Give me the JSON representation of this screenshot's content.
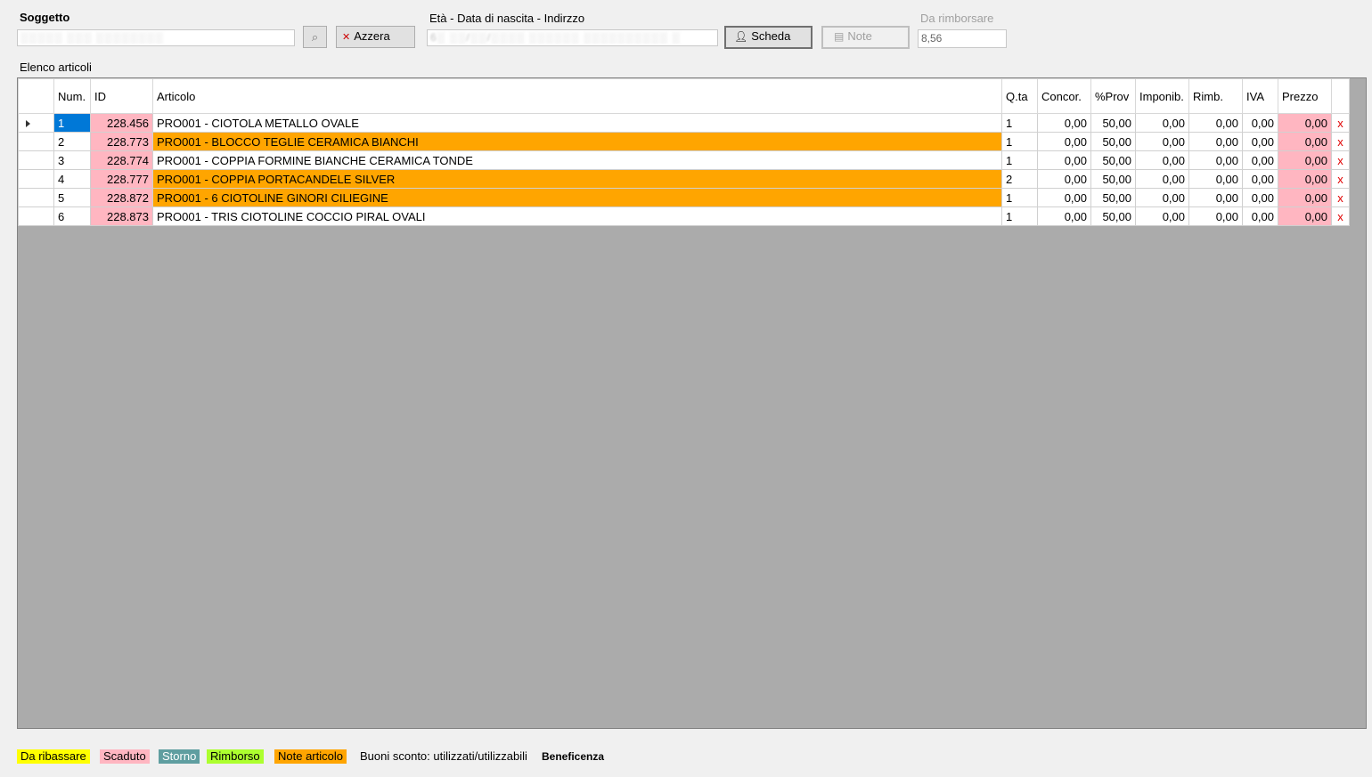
{
  "header": {
    "soggetto_label": "Soggetto",
    "soggetto_value": "░░░░░ ░░░ ░░░░░░░░",
    "azzera_label": "Azzera",
    "info_label": "Età - Data di nascita - Indirzzo",
    "info_value": "6░ ░░/░░/░░░░  ░░░░░░  ░░░░░░░░░░ ░",
    "scheda_label": "Scheda",
    "note_label": "Note",
    "rimborsare_label": "Da rimborsare",
    "rimborsare_value": "8,56"
  },
  "list_title": "Elenco articoli",
  "columns": [
    "Num.",
    "ID",
    "Articolo",
    "Q.ta",
    "Concor.",
    "%Prov",
    "Imponib.",
    "Rimb.",
    "IVA",
    "Prezzo"
  ],
  "rows": [
    {
      "num": "1",
      "id": "228.456",
      "articolo": "PRO001 - CIOTOLA METALLO OVALE",
      "qta": "1",
      "concor": "0,00",
      "prov": "50,00",
      "imponib": "0,00",
      "rimb": "0,00",
      "iva": "0,00",
      "prezzo": "0,00",
      "del": "x",
      "highlight": false,
      "selected": true
    },
    {
      "num": "2",
      "id": "228.773",
      "articolo": "PRO001 - BLOCCO TEGLIE CERAMICA BIANCHI",
      "qta": "1",
      "concor": "0,00",
      "prov": "50,00",
      "imponib": "0,00",
      "rimb": "0,00",
      "iva": "0,00",
      "prezzo": "0,00",
      "del": "x",
      "highlight": true,
      "selected": false
    },
    {
      "num": "3",
      "id": "228.774",
      "articolo": "PRO001 - COPPIA FORMINE BIANCHE CERAMICA TONDE",
      "qta": "1",
      "concor": "0,00",
      "prov": "50,00",
      "imponib": "0,00",
      "rimb": "0,00",
      "iva": "0,00",
      "prezzo": "0,00",
      "del": "x",
      "highlight": false,
      "selected": false
    },
    {
      "num": "4",
      "id": "228.777",
      "articolo": "PRO001 - COPPIA PORTACANDELE SILVER",
      "qta": "2",
      "concor": "0,00",
      "prov": "50,00",
      "imponib": "0,00",
      "rimb": "0,00",
      "iva": "0,00",
      "prezzo": "0,00",
      "del": "x",
      "highlight": true,
      "selected": false
    },
    {
      "num": "5",
      "id": "228.872",
      "articolo": "PRO001 - 6 CIOTOLINE GINORI CILIEGINE",
      "qta": "1",
      "concor": "0,00",
      "prov": "50,00",
      "imponib": "0,00",
      "rimb": "0,00",
      "iva": "0,00",
      "prezzo": "0,00",
      "del": "x",
      "highlight": true,
      "selected": false
    },
    {
      "num": "6",
      "id": "228.873",
      "articolo": "PRO001 - TRIS CIOTOLINE COCCIO PIRAL OVALI",
      "qta": "1",
      "concor": "0,00",
      "prov": "50,00",
      "imponib": "0,00",
      "rimb": "0,00",
      "iva": "0,00",
      "prezzo": "0,00",
      "del": "x",
      "highlight": false,
      "selected": false
    }
  ],
  "legend": {
    "da_ribassare": "Da ribassare",
    "scaduto": "Scaduto",
    "storno": "Storno",
    "rimborso": "Rimborso",
    "note_articolo": "Note articolo",
    "buoni": "Buoni sconto: utilizzati/utilizzabili",
    "beneficenza": "Beneficenza"
  },
  "colors": {
    "pink": "#ffb6c1",
    "orange": "#ffa500",
    "yellow": "#ffff00",
    "teal": "#5f9ea0",
    "green": "#adff2f",
    "selection": "#0078d7",
    "grid_bg": "#ababab"
  },
  "icons": {
    "search": "magnifier-icon",
    "azzera": "clear-icon",
    "scheda": "person-icon",
    "note": "note-icon",
    "row_pointer": "row-pointer-icon",
    "delete": "delete-icon"
  }
}
